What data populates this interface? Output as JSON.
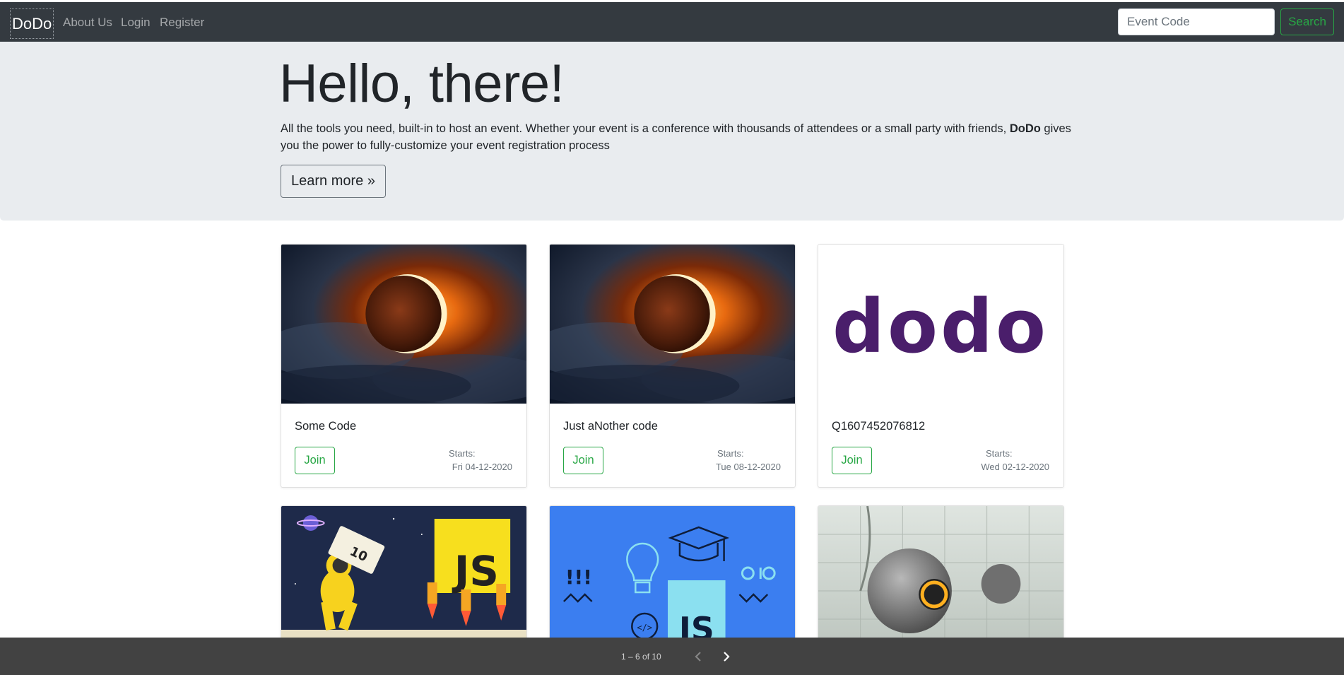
{
  "navbar": {
    "brand": "DoDo",
    "links": [
      "About Us",
      "Login",
      "Register"
    ],
    "search_placeholder": "Event Code",
    "search_label": "Search"
  },
  "jumbotron": {
    "title": "Hello, there!",
    "text_before": "All the tools you need, built-in to host an event. Whether your event is a conference with thousands of attendees or a small party with friends, ",
    "text_bold": "DoDo",
    "text_after": " gives you the power to fully-customize your event registration process",
    "button": "Learn more »"
  },
  "cards": [
    {
      "title": "Some Code",
      "join": "Join",
      "starts_label": "Starts:",
      "starts_date": "Fri 04-12-2020",
      "image": "solar-eclipse"
    },
    {
      "title": "Just aNother code",
      "join": "Join",
      "starts_label": "Starts:",
      "starts_date": "Tue 08-12-2020",
      "image": "solar-eclipse"
    },
    {
      "title": "Q1607452076812",
      "join": "Join",
      "starts_label": "Starts:",
      "starts_date": "Wed 02-12-2020",
      "image": "dodo-logo",
      "logo_text": "dodo"
    },
    {
      "title": "",
      "image": "js-astronaut",
      "badge_text": "JS",
      "ticket_text": "10"
    },
    {
      "title": "",
      "image": "js-learning",
      "badge_text": "JS",
      "exclaim_text": "!!!",
      "code_text": "</>"
    },
    {
      "title": "",
      "image": "portal-sphere"
    }
  ],
  "paginator": {
    "range": "1 – 6 of 10",
    "prev_icon": "chevron-left-icon",
    "next_icon": "chevron-right-icon"
  },
  "colors": {
    "navbar_bg": "#343a40",
    "accent_green": "#28a745",
    "jumbotron_bg": "#e9ecef",
    "paginator_bg": "#424242",
    "dodo_purple": "#4a1e6b"
  }
}
